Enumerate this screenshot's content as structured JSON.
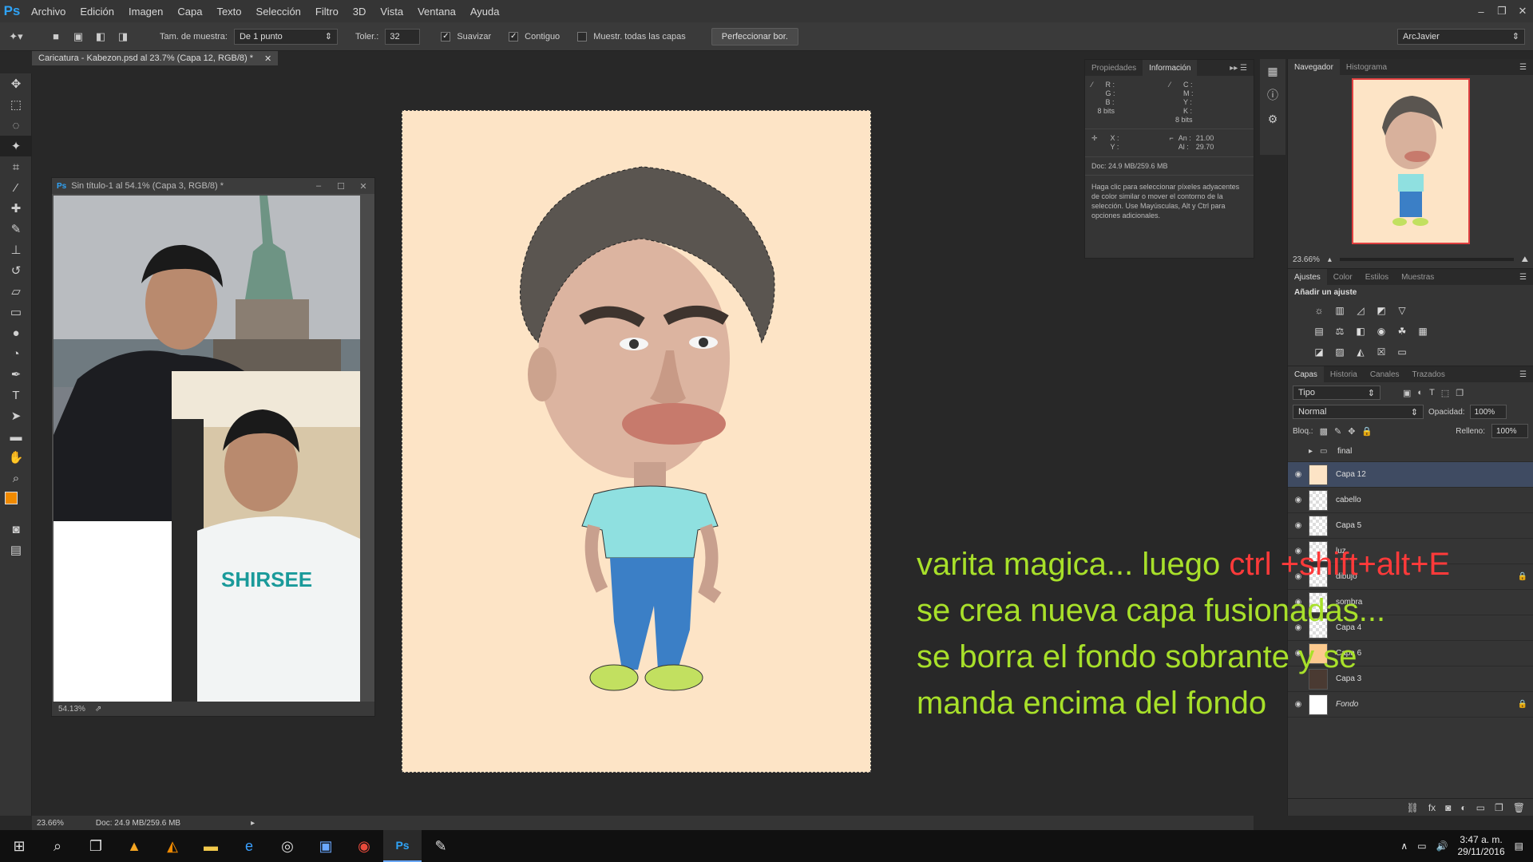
{
  "app": {
    "logo": "Ps",
    "menu": [
      "Archivo",
      "Edición",
      "Imagen",
      "Capa",
      "Texto",
      "Selección",
      "Filtro",
      "3D",
      "Vista",
      "Ventana",
      "Ayuda"
    ]
  },
  "options": {
    "sample_label": "Tam. de muestra:",
    "sample_value": "De 1 punto",
    "tolerance_label": "Toler.:",
    "tolerance_value": "32",
    "smooth_label": "Suavizar",
    "contiguous_label": "Contiguo",
    "all_layers_label": "Muestr. todas las capas",
    "refine_label": "Perfeccionar bor.",
    "workspace": "ArcJavier"
  },
  "document": {
    "tab_title": "Caricatura - Kabezon.psd al 23.7% (Capa 12, RGB/8) *",
    "zoom": "23.66%",
    "doc_size": "Doc: 24.9 MB/259.6 MB"
  },
  "float_window": {
    "title": "Sin título-1 al 54.1% (Capa 3, RGB/8) *",
    "zoom": "54.13%"
  },
  "info_panel": {
    "tabs": [
      "Propiedades",
      "Información"
    ],
    "rgb_keys": "R :\nG :\nB :",
    "cmyk_keys": "C :\nM :\nY :\nK :",
    "bits_left": "8 bits",
    "bits_right": "8 bits",
    "xy_keys": "X :\nY :",
    "size_keys": "An :\nAl :",
    "width": "21.00",
    "height": "29.70",
    "doc": "Doc: 24.9 MB/259.6 MB",
    "help": "Haga clic para seleccionar píxeles adyacentes de color similar o mover el contorno de la selección. Use Mayúsculas, Alt y Ctrl para opciones adicionales."
  },
  "navigator": {
    "tabs": [
      "Navegador",
      "Histograma"
    ],
    "zoom": "23.66%"
  },
  "adjustments": {
    "tabs": [
      "Ajustes",
      "Color",
      "Estilos",
      "Muestras"
    ],
    "heading": "Añadir un ajuste"
  },
  "layers": {
    "tabs": [
      "Capas",
      "Historia",
      "Canales",
      "Trazados"
    ],
    "filter": "Tipo",
    "blend": "Normal",
    "opacity_label": "Opacidad:",
    "opacity": "100%",
    "lock_label": "Bloq.:",
    "fill_label": "Relleno:",
    "fill": "100%",
    "items": [
      {
        "name": "final",
        "type": "group"
      },
      {
        "name": "Capa 12",
        "selected": true
      },
      {
        "name": "cabello"
      },
      {
        "name": "Capa 5"
      },
      {
        "name": "luz"
      },
      {
        "name": "dibujo",
        "locked": true
      },
      {
        "name": "sombra"
      },
      {
        "name": "Capa 4"
      },
      {
        "name": "Capa 6"
      },
      {
        "name": "Capa 3"
      },
      {
        "name": "Fondo",
        "locked": true
      }
    ]
  },
  "annotation": {
    "line1_a": "varita magica... luego ",
    "line1_b": "ctrl +shift+alt+E",
    "line2": "se crea nueva capa fusionadas...",
    "line3": "se borra el fondo sobrante y se",
    "line4": "manda encima del fondo"
  },
  "taskbar": {
    "time": "3:47 a. m.",
    "date": "29/11/2016"
  },
  "colors": {
    "canvas_bg": "#fde4c6",
    "annotation_green": "#a8e02a",
    "annotation_red": "#ff3a3a",
    "foreground": "#f08a00",
    "selected_layer": "#3f4b62"
  }
}
